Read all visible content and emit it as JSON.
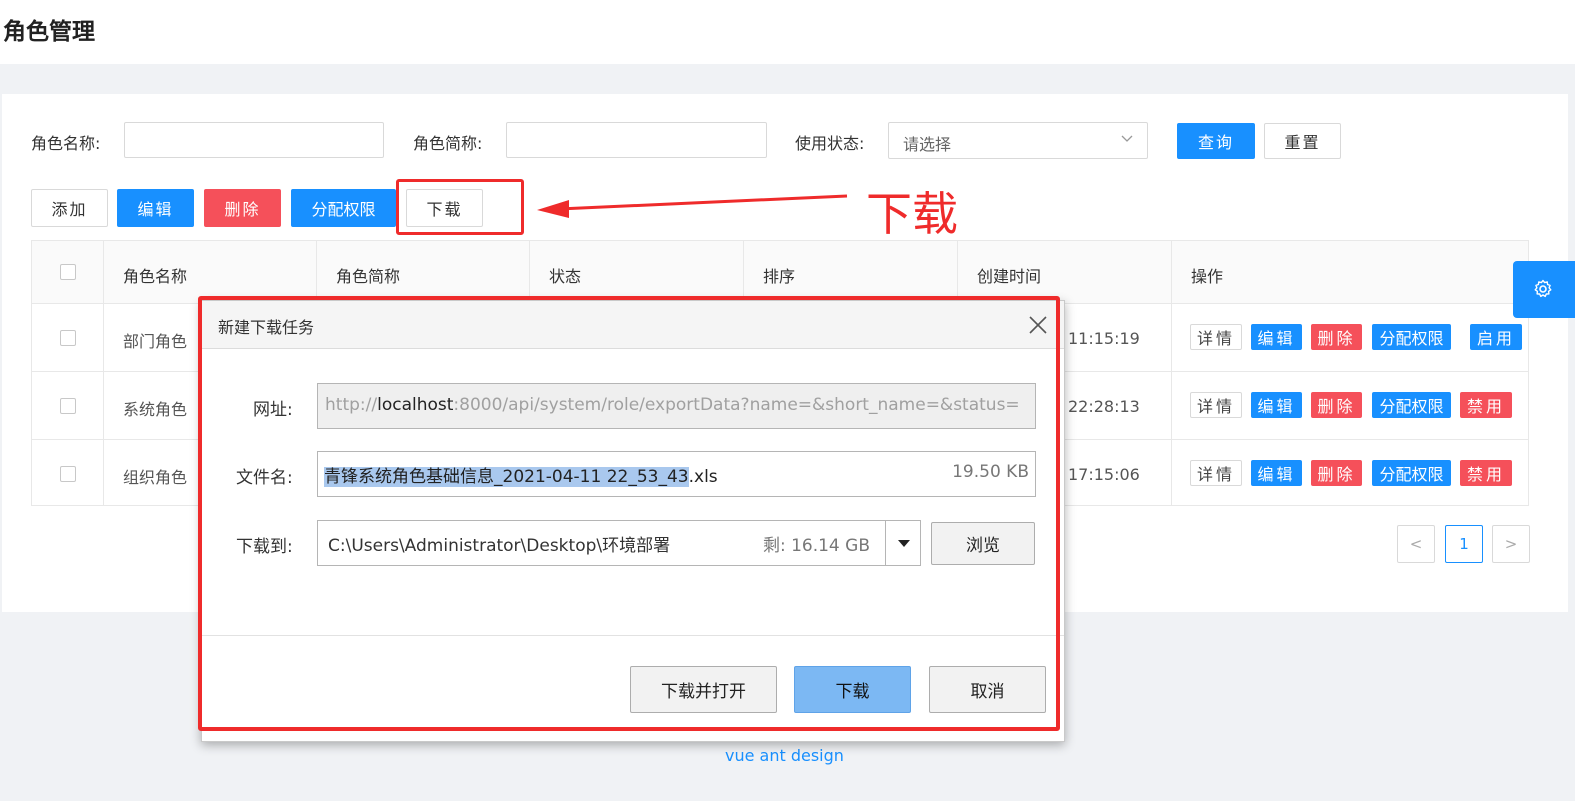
{
  "page": {
    "title": "角色管理"
  },
  "filters": {
    "role_name_label": "角色名称:",
    "role_short_label": "角色简称:",
    "status_label": "使用状态:",
    "status_placeholder": "请选择",
    "query": "查询",
    "reset": "重置"
  },
  "toolbar": {
    "add": "添加",
    "edit": "编辑",
    "delete": "删除",
    "assign": "分配权限",
    "download": "下载"
  },
  "annotation": {
    "text": "下载",
    "color": "#ef2b2b"
  },
  "table": {
    "headers": [
      "角色名称",
      "角色简称",
      "状态",
      "排序",
      "创建时间",
      "操作"
    ],
    "rows": [
      {
        "name": "部门角色",
        "time": "11:15:19",
        "toggle": "启用"
      },
      {
        "name": "系统角色",
        "time": "22:28:13",
        "toggle": "禁用"
      },
      {
        "name": "组织角色",
        "time": "17:15:06",
        "toggle": "禁用"
      }
    ],
    "actions": {
      "detail": "详情",
      "edit": "编辑",
      "delete": "删除",
      "assign": "分配权限"
    }
  },
  "pagination": {
    "prev": "<",
    "current": "1",
    "next": ">"
  },
  "dialog": {
    "title": "新建下载任务",
    "url_label": "网址:",
    "url_prefix": "http://",
    "url_host": "localhost",
    "url_rest": ":8000/api/system/role/exportData?name=&short_name=&status=",
    "filename_label": "文件名:",
    "filename_selected": "青锋系统角色基础信息_2021-04-11 22_53_43",
    "filename_ext": ".xls",
    "filesize": "19.50 KB",
    "saveto_label": "下载到:",
    "path": "C:\\Users\\Administrator\\Desktop\\环境部署",
    "free_space": "剩: 16.14 GB",
    "browse": "浏览",
    "download_open": "下载并打开",
    "download": "下载",
    "cancel": "取消"
  },
  "footer": {
    "link": "vue ant design"
  },
  "colors": {
    "primary": "#1890ff",
    "danger": "#f5505a",
    "annotation": "#ef2b2b"
  }
}
